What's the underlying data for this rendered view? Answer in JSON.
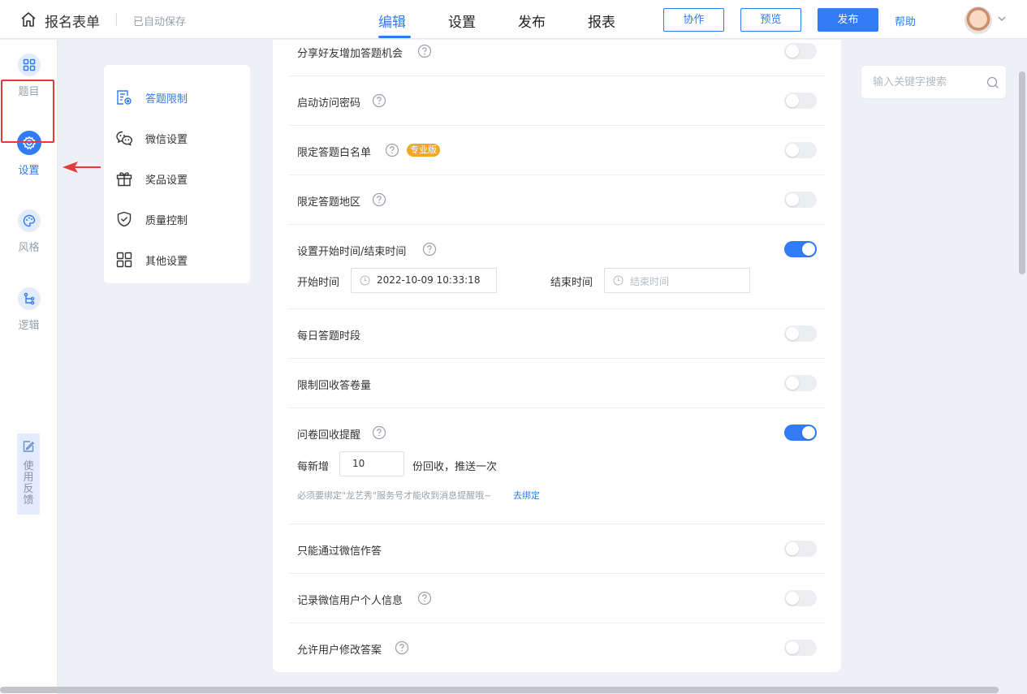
{
  "header": {
    "title": "报名表单",
    "autosave": "已自动保存",
    "tabs": [
      "编辑",
      "设置",
      "发布",
      "报表"
    ],
    "buttons": {
      "collab": "协作",
      "preview": "预览",
      "publish": "发布"
    },
    "help": "帮助"
  },
  "rail": {
    "items": [
      "题目",
      "设置",
      "风格",
      "逻辑"
    ],
    "feedback": "使用反馈"
  },
  "submenu": [
    "答题限制",
    "微信设置",
    "奖品设置",
    "质量控制",
    "其他设置"
  ],
  "search": {
    "placeholder": "输入关键字搜索"
  },
  "settings": {
    "share": "分享好友增加答题机会",
    "password": "启动访问密码",
    "whitelist": "限定答题白名单",
    "pro_badge": "专业版",
    "region": "限定答题地区",
    "time_range": "设置开始时间/结束时间",
    "start_label": "开始时间",
    "start_value": "2022-10-09 10:33:18",
    "end_label": "结束时间",
    "end_placeholder": "结束时间",
    "daily": "每日答题时段",
    "limit_count": "限制回收答卷量",
    "reminder": "问卷回收提醒",
    "every_new": "每新增",
    "every_value": "10",
    "push_text": "份回收，推送一次",
    "bind_hint": "必须要绑定\"龙艺秀\"服务号才能收到消息提醒哦~",
    "bind_link": "去绑定",
    "wechat_only": "只能通过微信作答",
    "record_wechat": "记录微信用户个人信息",
    "allow_edit": "允许用户修改答案"
  },
  "toggles": {
    "share": false,
    "password": false,
    "whitelist": false,
    "region": false,
    "time_range": true,
    "daily": false,
    "limit_count": false,
    "reminder": true,
    "wechat_only": false,
    "record_wechat": false,
    "allow_edit": false
  },
  "colors": {
    "accent": "#2f7cf6",
    "highlight": "#e53b3b",
    "badge": "#f5a623"
  }
}
